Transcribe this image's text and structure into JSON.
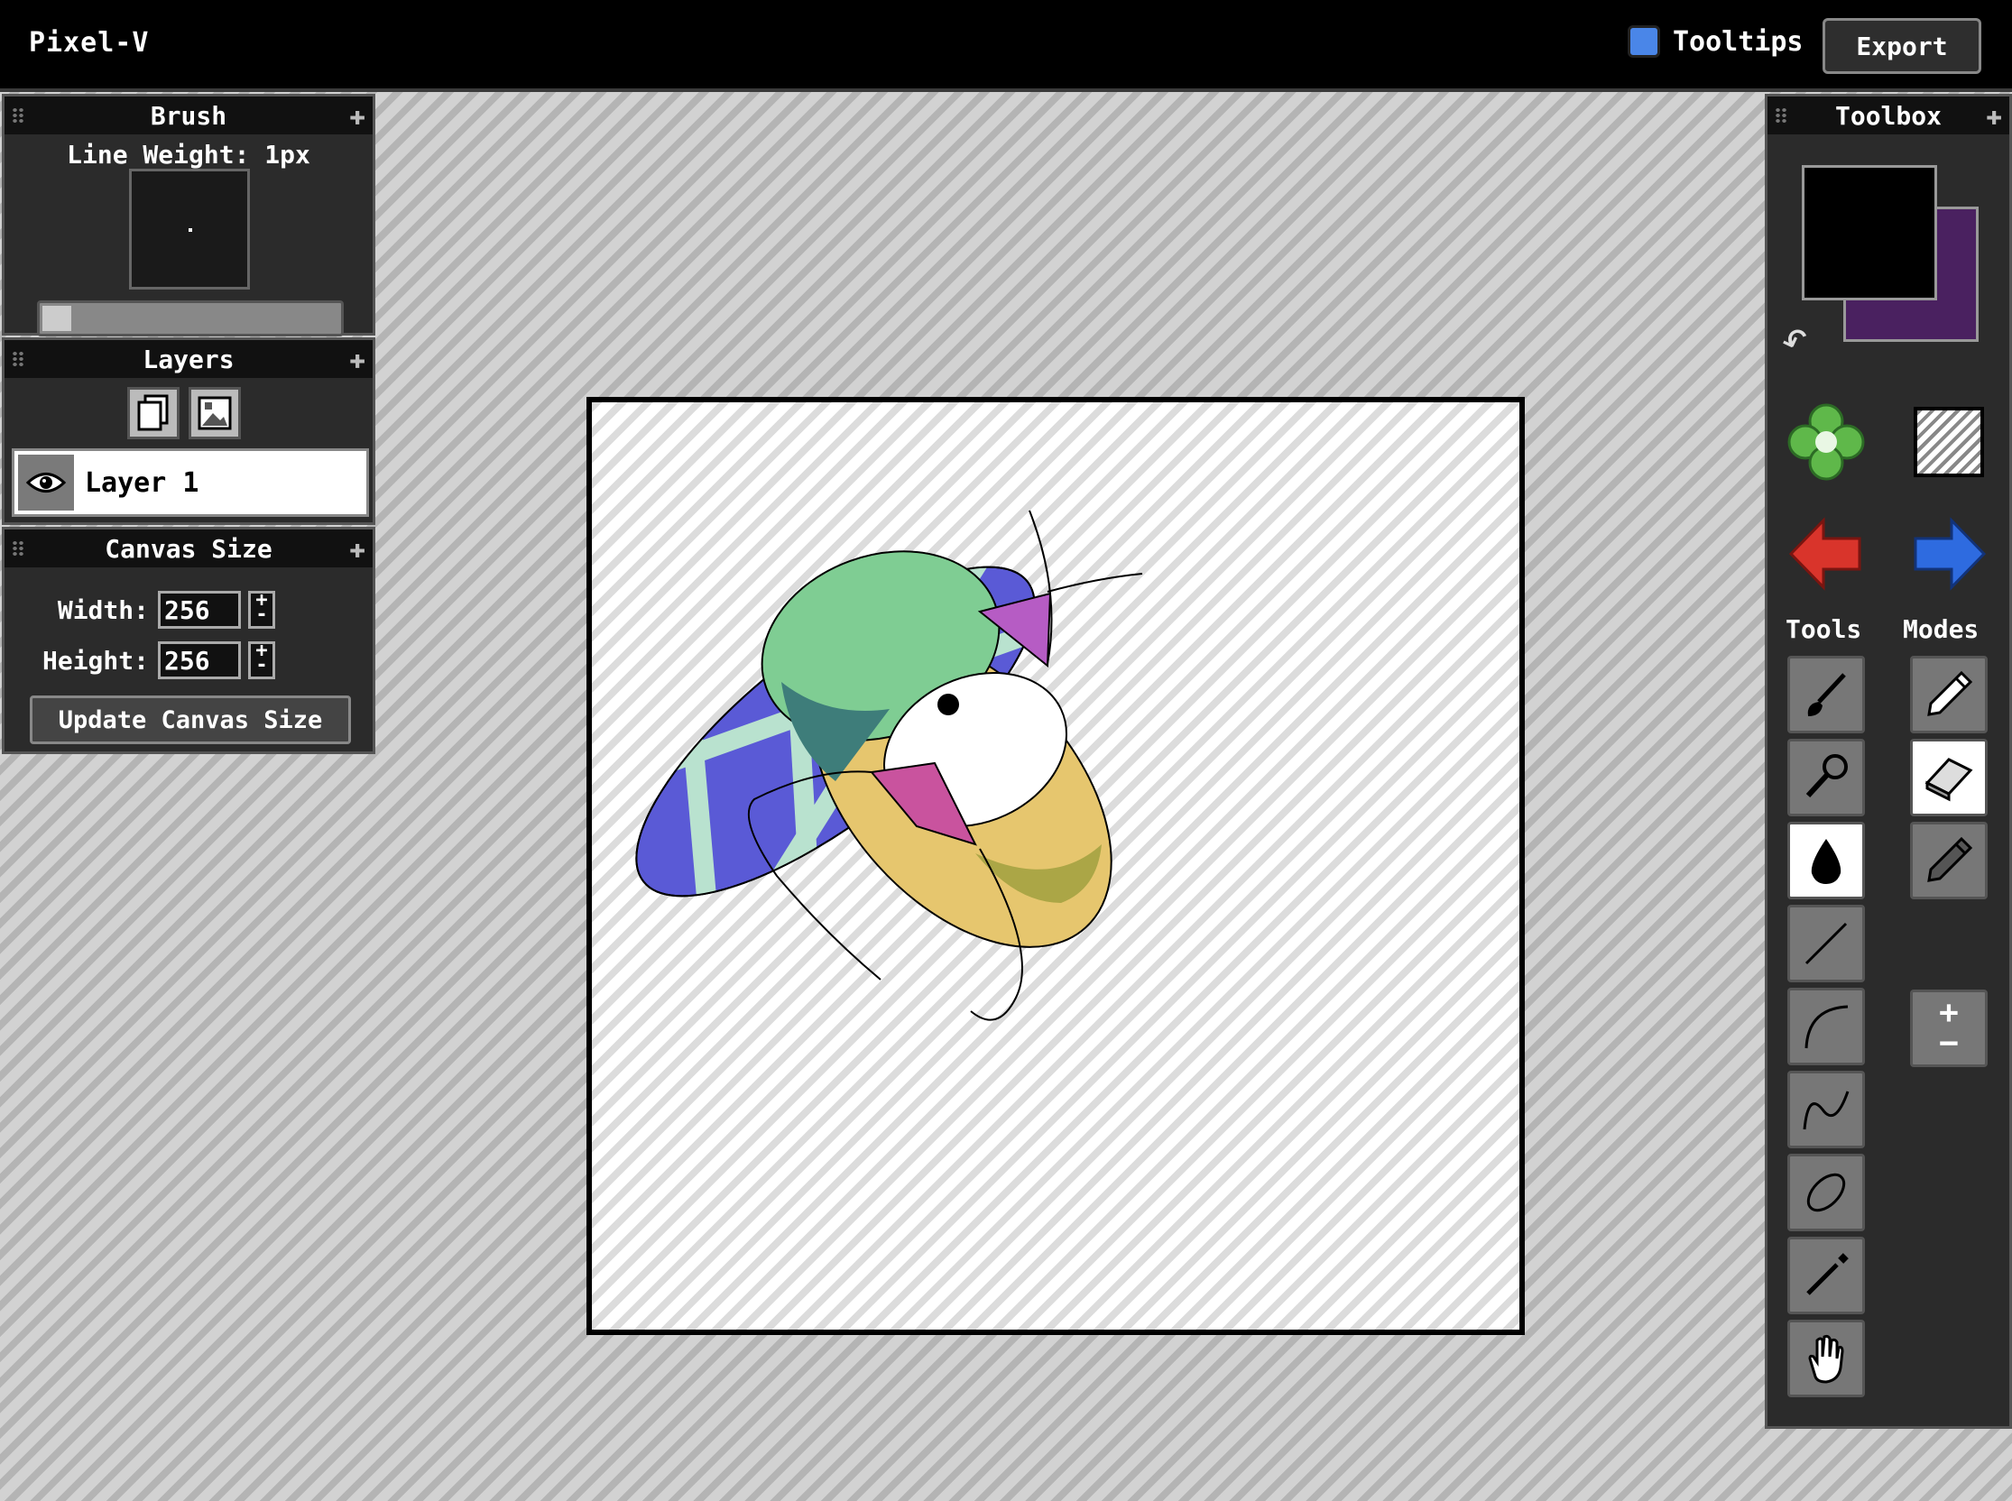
{
  "app": {
    "title": "Pixel-V"
  },
  "header": {
    "tooltips_label": "Tooltips",
    "tooltips_color": "#4a86e8",
    "export_label": "Export"
  },
  "brush": {
    "title": "Brush",
    "line_weight_label": "Line Weight: 1px",
    "slider_value": 0.0
  },
  "layers": {
    "title": "Layers",
    "items": [
      {
        "name": "Layer 1",
        "visible": true,
        "selected": true
      }
    ]
  },
  "canvas_size": {
    "title": "Canvas Size",
    "width_label": "Width:",
    "width_value": "256",
    "height_label": "Height:",
    "height_value": "256",
    "update_label": "Update Canvas Size"
  },
  "toolbox": {
    "title": "Toolbox",
    "primary_color": "#000000",
    "secondary_color": "#4a2160",
    "tools_label": "Tools",
    "modes_label": "Modes",
    "tools": [
      "brush-icon",
      "brush-pen-icon",
      "fill-icon",
      "line-icon",
      "curve-icon",
      "freehand-curve-icon",
      "ellipse-icon",
      "eyedropper-icon",
      "hand-icon"
    ],
    "active_tool": "fill-icon",
    "modes": [
      "pencil-icon",
      "eraser-icon",
      "pencil-alt-icon"
    ],
    "active_mode": "eraser-icon"
  }
}
